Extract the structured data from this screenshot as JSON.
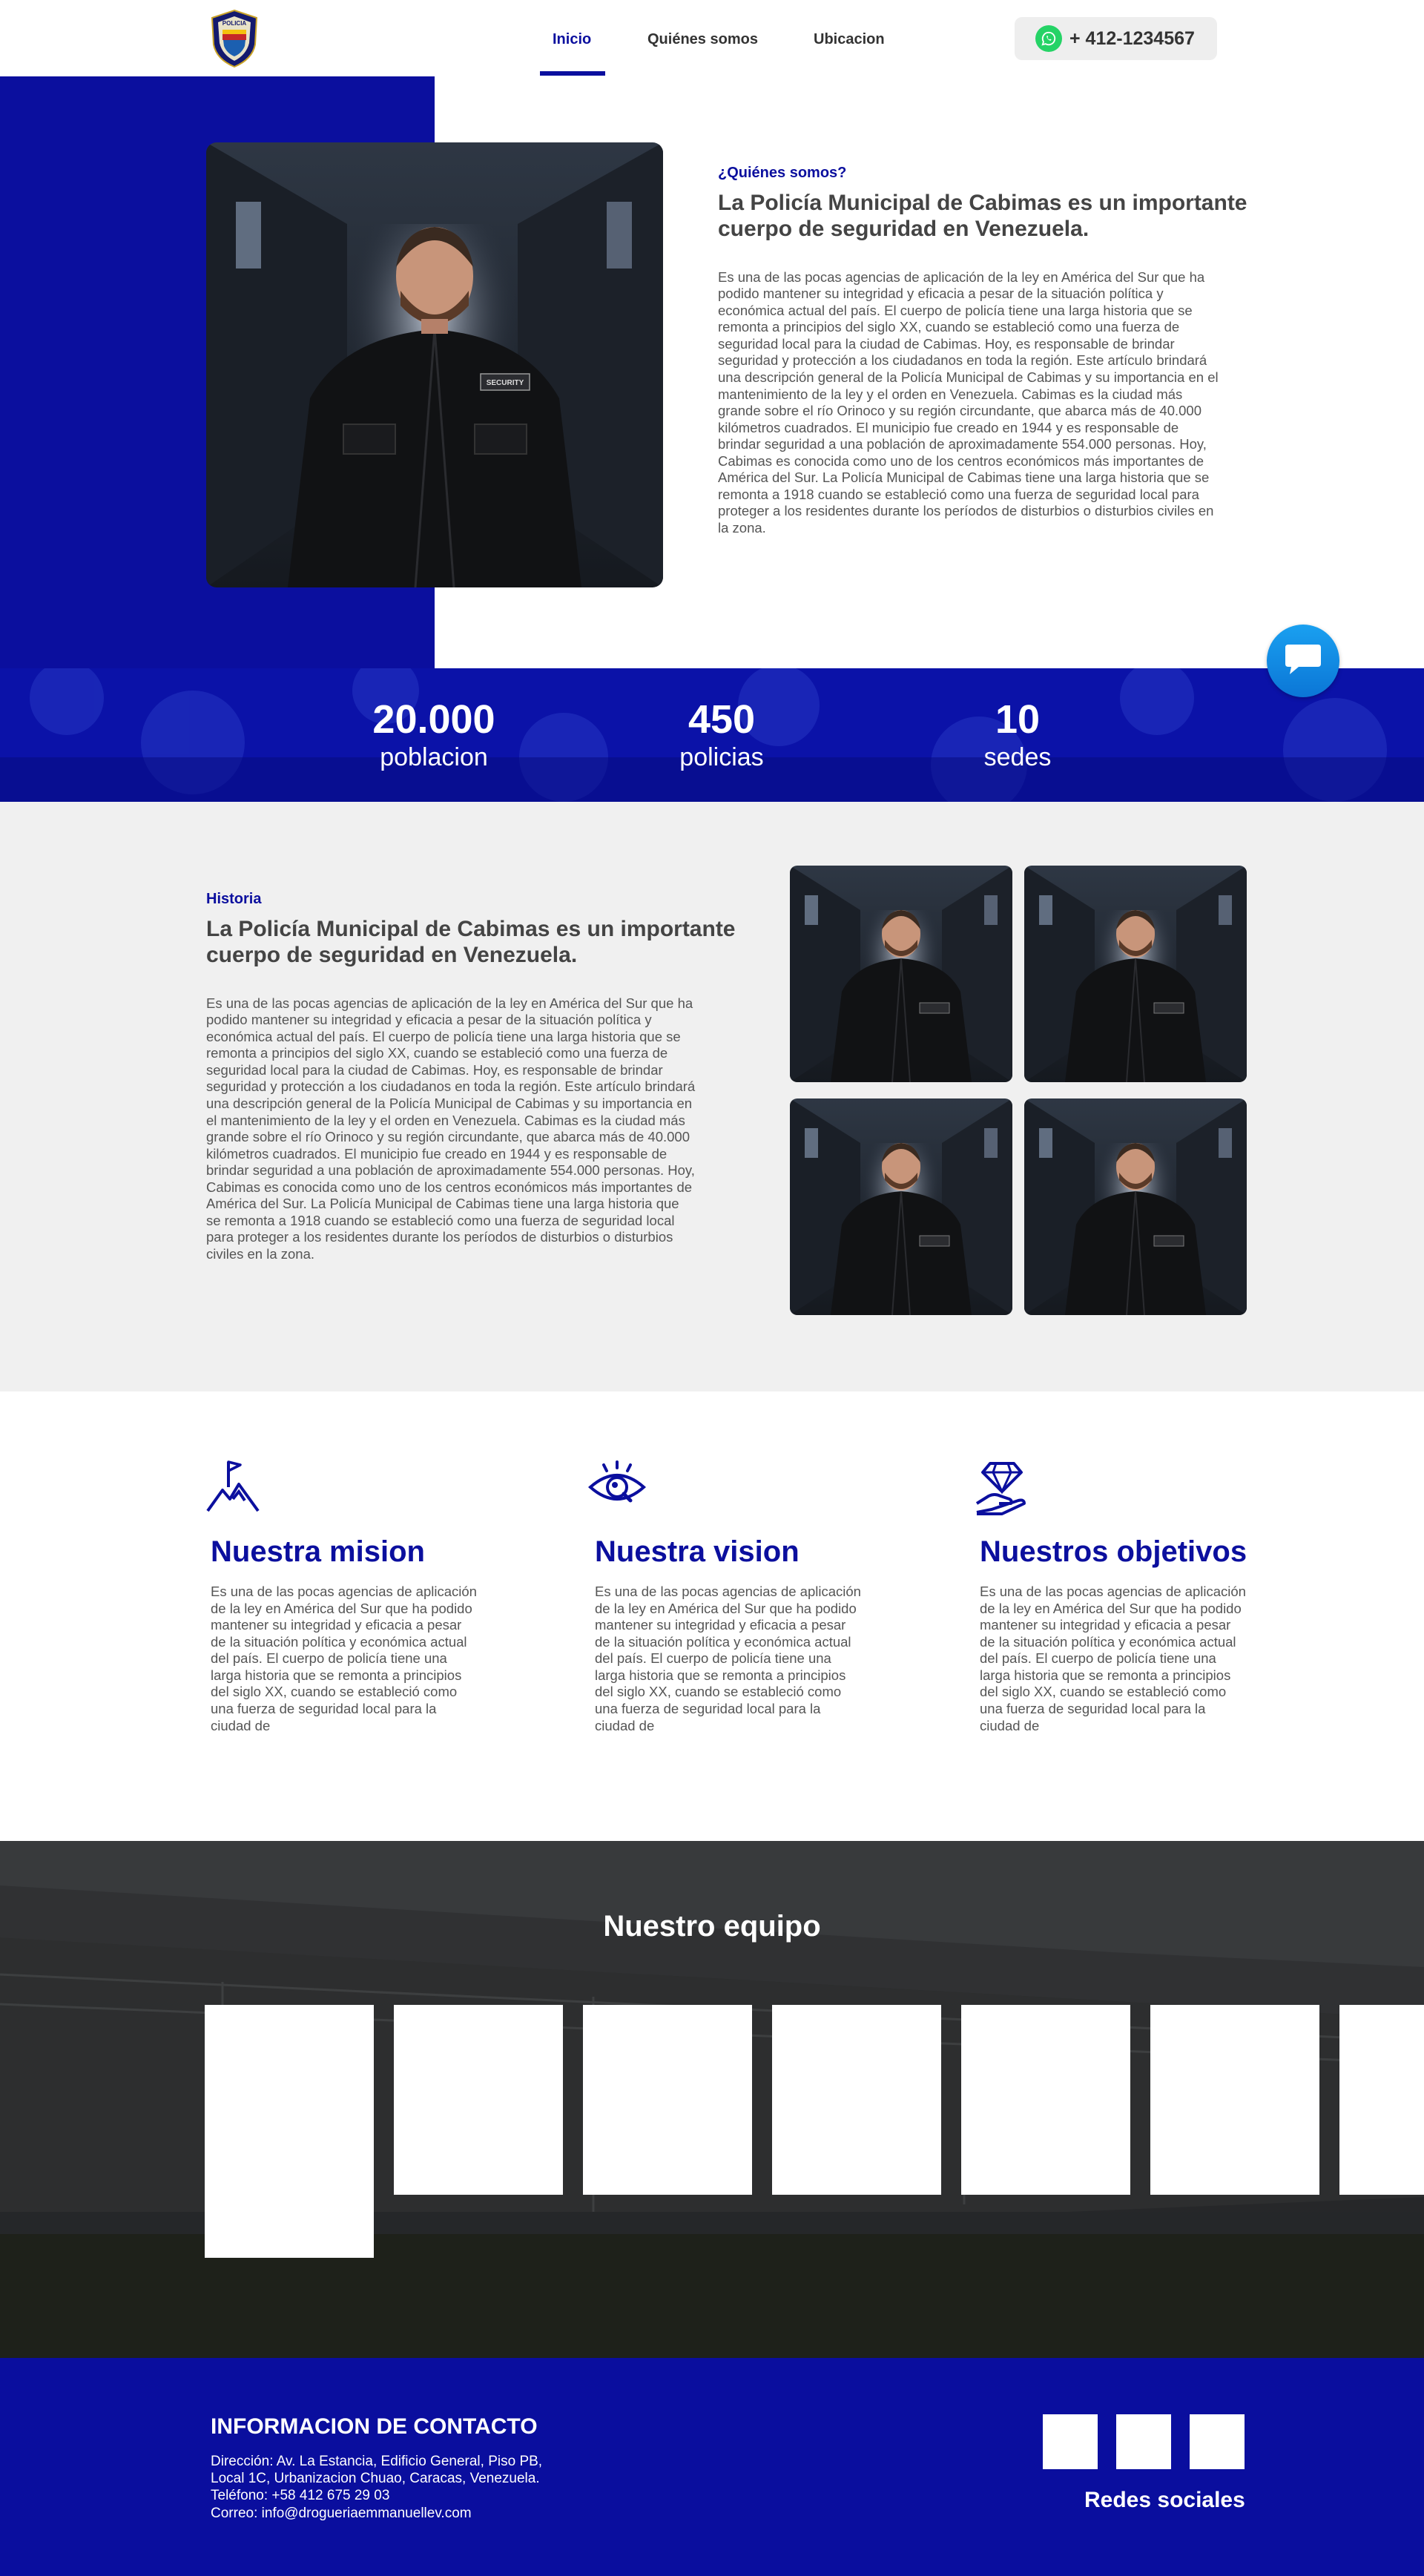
{
  "nav": {
    "logo_text": "POLICIA",
    "links": [
      {
        "label": "Inicio",
        "active": true
      },
      {
        "label": "Quiénes somos",
        "active": false
      },
      {
        "label": "Ubicacion",
        "active": false
      }
    ],
    "phone": "+ 412-1234567",
    "phone_icon": "whatsapp-icon"
  },
  "about": {
    "eyebrow": "¿Quiénes somos?",
    "title": "La Policía Municipal de Cabimas es un importante cuerpo de seguridad en Venezuela.",
    "body": "Es una de las pocas agencias de aplicación de la ley en América del Sur que ha podido mantener su integridad y eficacia a pesar de la situación política y económica actual del país. El cuerpo de policía tiene una larga historia que se remonta a principios del siglo XX, cuando se estableció como una fuerza de seguridad local para la ciudad de Cabimas. Hoy, es responsable de brindar seguridad y protección a los ciudadanos en toda la región. Este artículo brindará una descripción general de la Policía Municipal de Cabimas y su importancia en el mantenimiento de la ley y el orden en Venezuela. Cabimas es la ciudad más grande sobre el río Orinoco y su región circundante, que abarca más de 40.000 kilómetros cuadrados. El municipio fue creado en 1944 y es responsable de brindar seguridad a una población de aproximadamente 554.000 personas. Hoy, Cabimas es conocida como uno de los centros económicos más importantes de América del Sur. La Policía Municipal de Cabimas tiene una larga historia que se remonta a 1918 cuando se estableció como una fuerza de seguridad local para proteger a los residentes durante los períodos de disturbios o disturbios civiles en la zona.",
    "photo_badge": "SECURITY"
  },
  "stats": [
    {
      "value": "20.000",
      "label": "poblacion"
    },
    {
      "value": "450",
      "label": "policias"
    },
    {
      "value": "10",
      "label": "sedes"
    }
  ],
  "history": {
    "eyebrow": "Historia",
    "title": "La Policía Municipal de Cabimas es un importante cuerpo de seguridad en Venezuela.",
    "body": "Es una de las pocas agencias de aplicación de la ley en América del Sur que ha podido mantener su integridad y eficacia a pesar de la situación política y económica actual del país. El cuerpo de policía tiene una larga historia que se remonta a principios del siglo XX, cuando se estableció como una fuerza de seguridad local para la ciudad de Cabimas. Hoy, es responsable de brindar seguridad y protección a los ciudadanos en toda la región. Este artículo brindará una descripción general de la Policía Municipal de Cabimas y su importancia en el mantenimiento de la ley y el orden en Venezuela. Cabimas es la ciudad más grande sobre el río Orinoco y su región circundante, que abarca más de 40.000 kilómetros cuadrados. El municipio fue creado en 1944 y es responsable de brindar seguridad a una población de aproximadamente 554.000 personas. Hoy, Cabimas es conocida como uno de los centros económicos más importantes de América del Sur. La Policía Municipal de Cabimas tiene una larga historia que se remonta a 1918 cuando se estableció como una fuerza de seguridad local para proteger a los residentes durante los períodos de disturbios o disturbios civiles en la zona."
  },
  "mvo": [
    {
      "icon": "mountain-flag-icon",
      "title": "Nuestra mision",
      "body": "Es una de las pocas agencias de aplicación de la ley en América del Sur que ha podido mantener su integridad y eficacia a pesar de la situación política y económica actual del país. El cuerpo de policía tiene una larga historia que se remonta a principios del siglo XX, cuando se estableció como una fuerza de seguridad local para la ciudad de"
    },
    {
      "icon": "eye-search-icon",
      "title": "Nuestra vision",
      "body": "Es una de las pocas agencias de aplicación de la ley en América del Sur que ha podido mantener su integridad y eficacia a pesar de la situación política y económica actual del país. El cuerpo de policía tiene una larga historia que se remonta a principios del siglo XX, cuando se estableció como una fuerza de seguridad local para la ciudad de"
    },
    {
      "icon": "diamond-hand-icon",
      "title": "Nuestros objetivos",
      "body": "Es una de las pocas agencias de aplicación de la ley en América del Sur que ha podido mantener su integridad y eficacia a pesar de la situación política y económica actual del país. El cuerpo de policía tiene una larga historia que se remonta a principios del siglo XX, cuando se estableció como una fuerza de seguridad local para la ciudad de"
    }
  ],
  "team": {
    "title": "Nuestro equipo"
  },
  "footer": {
    "title": "INFORMACION DE CONTACTO",
    "lines": [
      "Dirección: Av. La Estancia, Edificio General, Piso PB,",
      "Local 1C, Urbanizacion Chuao, Caracas, Venezuela.",
      "Teléfono: +58 412 675 29 03",
      "Correo: info@drogueriaemmanuellev.com"
    ],
    "social_label": "Redes sociales"
  },
  "colors": {
    "brand_blue": "#0b0f9e",
    "light_bg": "#f0f0f0",
    "whatsapp": "#25d366",
    "chat_blue": "#1a8fe8"
  }
}
